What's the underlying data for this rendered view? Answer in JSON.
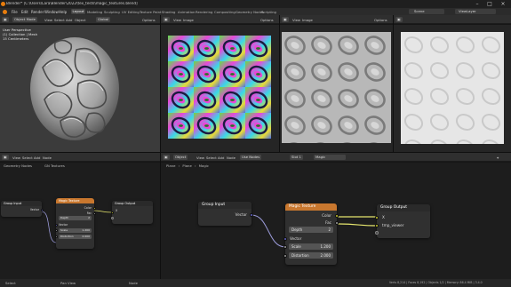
{
  "window": {
    "title": "Blender* [C:\\Users\\Lara\\Blender\\2022\\tex_tests\\magic_textures.blend]"
  },
  "menu": [
    "File",
    "Edit",
    "Render",
    "Window",
    "Help"
  ],
  "workspaces": [
    "Layout",
    "Modeling",
    "Sculpting",
    "UV Editing",
    "Texture Paint",
    "Shading",
    "Animation",
    "Rendering",
    "Compositing",
    "Geometry Nodes",
    "Scripting"
  ],
  "active_workspace": "Layout",
  "scene": {
    "name": "Scene",
    "view_layer": "ViewLayer"
  },
  "viewport3d": {
    "mode": "Object Mode",
    "menus": [
      "View",
      "Select",
      "Add",
      "Object"
    ],
    "shading": "Global",
    "options_label": "Options",
    "overlay_lines": [
      "User Perspective",
      "(1) Collection | Mesh",
      "15 Centimeters"
    ]
  },
  "image_editors": [
    {
      "menus": [
        "View",
        "Image"
      ],
      "options_label": "Options"
    },
    {
      "menus": [
        "View",
        "Image"
      ],
      "options_label": "Options"
    }
  ],
  "node_editor_left": {
    "menus": [
      "View",
      "Select",
      "Add",
      "Node"
    ],
    "tree_type": "Geometry Nodes",
    "tree_name": "GN Textures",
    "nodes": {
      "group_input": {
        "title": "Group Input",
        "outputs": [
          "Vector"
        ]
      },
      "magic_texture": {
        "title": "Magic Texture",
        "outputs": [
          "Color",
          "Fac"
        ],
        "depth_label": "Depth",
        "depth_value": "2",
        "vector_label": "Vector",
        "scale_label": "Scale",
        "scale_value": "1.200",
        "distortion_label": "Distortion",
        "distortion_value": "2.000"
      },
      "group_output": {
        "title": "Group Output",
        "inputs": [
          "X"
        ]
      }
    }
  },
  "node_editor_right": {
    "menus": [
      "View",
      "Select",
      "Add",
      "Node"
    ],
    "object_label": "Object",
    "slot_label": "Slot 1",
    "material_name": "Magic",
    "breadcrumb": [
      "Plane",
      "Plane",
      "Magic"
    ],
    "use_nodes_label": "Use Nodes",
    "nodes": {
      "group_input": {
        "title": "Group Input",
        "outputs": [
          "Vector"
        ]
      },
      "magic_texture": {
        "title": "Magic Texture",
        "outputs": [
          "Color",
          "Fac"
        ],
        "depth_label": "Depth",
        "depth_value": "2",
        "vector_label": "Vector",
        "scale_label": "Scale",
        "scale_value": "1.200",
        "distortion_label": "Distortion",
        "distortion_value": "2.000"
      },
      "group_output": {
        "title": "Group Output",
        "inputs": [
          "X",
          "tmp_viewer"
        ]
      }
    }
  },
  "statusbar": {
    "left": [
      "Select",
      "Pan View",
      "Node"
    ],
    "right": "Verts 8,214 | Faces 8,192 | Objects 1/2 | Memory: 86.4 MiB | 3.4.0"
  },
  "colors": {
    "bg": "#161616",
    "header": "#2f2f2f",
    "node_body": "#303030",
    "texture_header": "#c8772e",
    "group_header": "#2a2a2a",
    "socket_color": "#c7c729",
    "socket_float": "#a1a1a1",
    "socket_vector": "#6363c7",
    "link_color": "#e6e66e",
    "link_vector": "#9a9ad8"
  },
  "icons": [
    "blender-logo-icon",
    "minimize-icon",
    "maximize-icon",
    "close-icon",
    "editor-type-icon",
    "pin-icon",
    "camera-view-icon"
  ]
}
